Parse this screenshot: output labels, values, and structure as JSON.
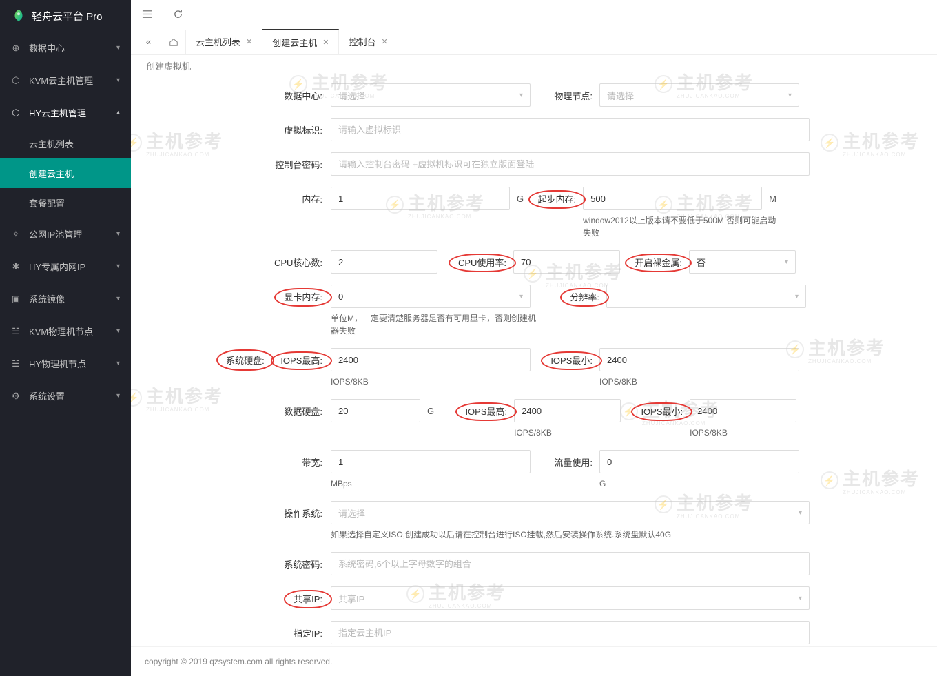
{
  "brand": "轻舟云平台 Pro",
  "watermark": {
    "text": "主机参考",
    "sub": "ZHUJICANKAO.COM"
  },
  "sidebar": {
    "items": [
      {
        "label": "数据中心"
      },
      {
        "label": "KVM云主机管理"
      },
      {
        "label": "HY云主机管理"
      },
      {
        "label": "公网IP池管理"
      },
      {
        "label": "HY专属内网IP"
      },
      {
        "label": "系统镜像"
      },
      {
        "label": "KVM物理机节点"
      },
      {
        "label": "HY物理机节点"
      },
      {
        "label": "系统设置"
      }
    ],
    "sub_hy": [
      {
        "label": "云主机列表"
      },
      {
        "label": "创建云主机"
      },
      {
        "label": "套餐配置"
      }
    ]
  },
  "tabs": {
    "items": [
      {
        "label": "云主机列表"
      },
      {
        "label": "创建云主机"
      },
      {
        "label": "控制台"
      }
    ]
  },
  "crumb": "创建虚拟机",
  "form": {
    "data_center": {
      "label": "数据中心:",
      "placeholder": "请选择"
    },
    "node": {
      "label": "物理节点:",
      "placeholder": "请选择"
    },
    "vm_id": {
      "label": "虚拟标识:",
      "placeholder": "请输入虚拟标识"
    },
    "console_pwd": {
      "label": "控制台密码:",
      "placeholder": "请输入控制台密码 +虚拟机标识可在独立版面登陆"
    },
    "memory": {
      "label": "内存:",
      "value": "1",
      "unit": "G"
    },
    "start_memory": {
      "label": "起步内存:",
      "value": "500",
      "unit": "M",
      "hint": "window2012以上版本请不要低于500M 否则可能启动失败"
    },
    "cpu_cores": {
      "label": "CPU核心数:",
      "value": "2"
    },
    "cpu_usage": {
      "label": "CPU使用率:",
      "value": "70"
    },
    "bare_metal": {
      "label": "开启裸金属:",
      "value": "否"
    },
    "gpu_mem": {
      "label": "显卡内存:",
      "value": "0",
      "hint": "单位M，一定要清楚服务器是否有可用显卡，否则创建机器失败"
    },
    "resolution": {
      "label": "分辨率:",
      "value": ""
    },
    "sys_disk": {
      "label": "系统硬盘:"
    },
    "iops_max": {
      "label": "IOPS最高:",
      "value": "2400",
      "hint": "IOPS/8KB"
    },
    "iops_min": {
      "label": "IOPS最小:",
      "value": "2400",
      "hint": "IOPS/8KB"
    },
    "data_disk": {
      "label": "数据硬盘:",
      "value": "20",
      "unit": "G"
    },
    "data_iops_max": {
      "label": "IOPS最高:",
      "value": "2400",
      "hint": "IOPS/8KB"
    },
    "data_iops_min": {
      "label": "IOPS最小:",
      "value": "2400",
      "hint": "IOPS/8KB"
    },
    "bandwidth": {
      "label": "带宽:",
      "value": "1",
      "unit": "MBps"
    },
    "traffic": {
      "label": "流量使用:",
      "value": "0",
      "unit": "G"
    },
    "os": {
      "label": "操作系统:",
      "placeholder": "请选择",
      "hint": "如果选择自定义ISO,创建成功以后请在控制台进行ISO挂载,然后安装操作系统.系统盘默认40G"
    },
    "sys_pwd": {
      "label": "系统密码:",
      "placeholder": "系统密码,6个以上字母数字的组合"
    },
    "share_ip": {
      "label": "共享IP:",
      "placeholder": "共享IP"
    },
    "assign_ip": {
      "label": "指定IP:",
      "placeholder": "指定云主机IP"
    }
  },
  "footer": "copyright © 2019 qzsystem.com all rights reserved."
}
